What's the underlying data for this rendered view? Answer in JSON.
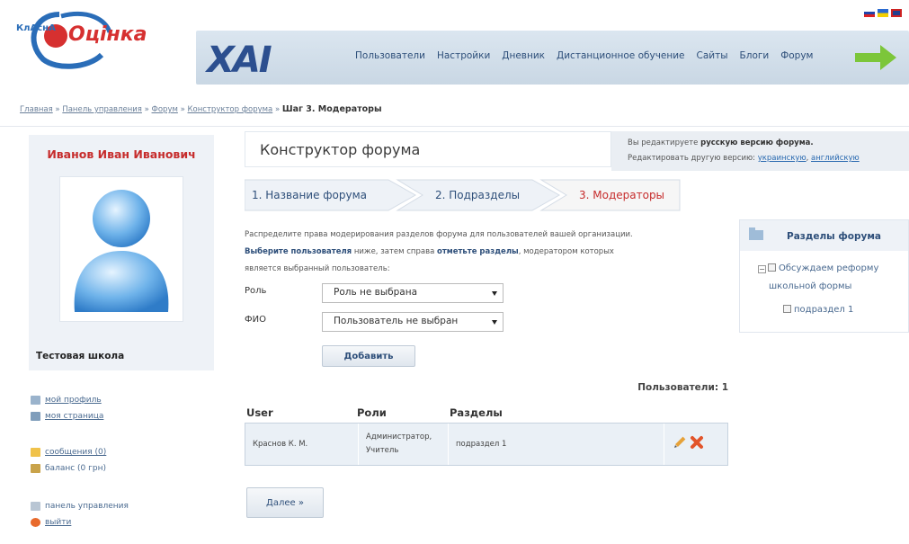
{
  "header": {
    "logo_prefix": "КлАснА",
    "logo_text": "Оцінка",
    "brand_mark": "XAI",
    "nav": [
      "Пользователи",
      "Настройки",
      "Дневник",
      "Дистанционное обучение",
      "Сайты",
      "Блоги",
      "Форум"
    ],
    "flags": [
      "ru",
      "ua",
      "gb"
    ]
  },
  "breadcrumb": {
    "items": [
      "Главная",
      "Панель управления",
      "Форум",
      "Конструктор форума"
    ],
    "separator": " » ",
    "current": "Шаг 3. Модераторы"
  },
  "profile": {
    "name": "Иванов Иван Иванович",
    "school": "Тестовая школа"
  },
  "side_links": {
    "profile": "мой профиль",
    "page": "моя страница",
    "messages": "сообщения (0)",
    "balance": "баланс (0 грн)",
    "control_panel": "панель управления",
    "logout": "выйти"
  },
  "main": {
    "title": "Конструктор форума",
    "edit_note_prefix": "Вы редактируете ",
    "edit_note_bold": "русскую версию форума.",
    "edit_other_prefix": "Редактировать другую версию: ",
    "edit_other_lang1": "украинскую",
    "edit_other_lang2": "английскую",
    "steps": [
      "1. Название форума",
      "2. Подразделы",
      "3. Модераторы"
    ],
    "info_line1": "Распределите права модерирования разделов форума для пользователей вашей организации.",
    "info_bold1": "Выберите пользователя",
    "info_mid": " ниже, затем справа ",
    "info_bold2": "отметьте разделы",
    "info_end": ", модератором которых",
    "info_line3": "является выбранный пользователь:",
    "role_label": "Роль",
    "role_value": "Роль не выбрана",
    "fio_label": "ФИО",
    "fio_value": "Пользователь не выбран",
    "add_button": "Добавить",
    "users_count": "Пользователи: 1",
    "table_headers": [
      "User",
      "Роли",
      "Разделы"
    ],
    "rows": [
      {
        "user": "Краснов К. М.",
        "roles_line1": "Администратор,",
        "roles_line2": "Учитель",
        "sections": "подраздел 1"
      }
    ],
    "next_button": "Далее »"
  },
  "sections_panel": {
    "title": "Разделы форума",
    "topic": "Обсуждаем реформу",
    "topic_line2": "школьной формы",
    "sub": "подраздел 1"
  },
  "colors": {
    "accent_red": "#c62c2c",
    "nav_blue": "#2e4f7a",
    "panel_bg": "#eef2f7",
    "arrow_green": "#7cc63a"
  }
}
